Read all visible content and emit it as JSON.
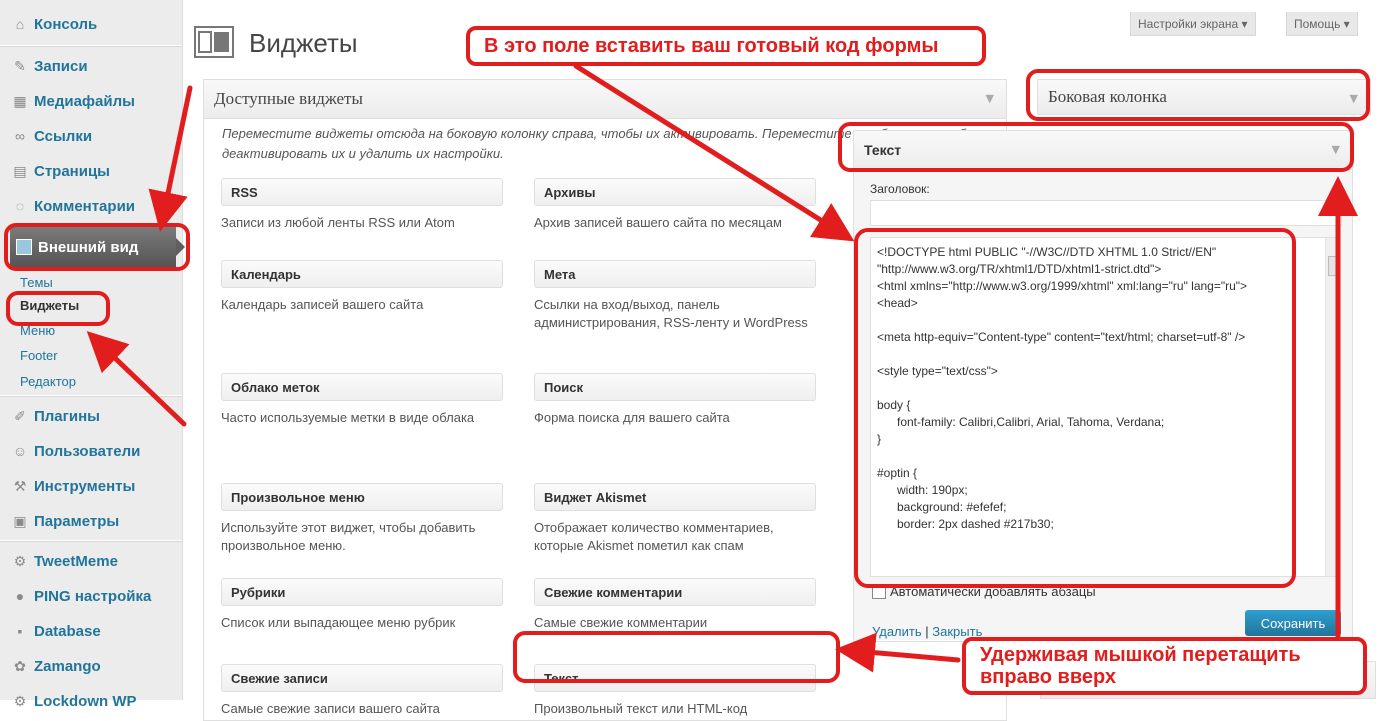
{
  "sidebar": {
    "items": [
      {
        "icon": "home-icon",
        "glyph": "⌂",
        "label": "Консоль"
      },
      {
        "icon": "pin-icon",
        "glyph": "✎",
        "label": "Записи"
      },
      {
        "icon": "media-icon",
        "glyph": "▦",
        "label": "Медиафайлы"
      },
      {
        "icon": "link-icon",
        "glyph": "∞",
        "label": "Ссылки"
      },
      {
        "icon": "page-icon",
        "glyph": "▤",
        "label": "Страницы"
      },
      {
        "icon": "comment-icon",
        "glyph": "◌",
        "label": "Комментарии"
      },
      {
        "icon": "appearance-icon",
        "glyph": "",
        "label": "Внешний вид"
      },
      {
        "icon": "plugin-icon",
        "glyph": "✐",
        "label": "Плагины"
      },
      {
        "icon": "users-icon",
        "glyph": "☺",
        "label": "Пользователи"
      },
      {
        "icon": "tools-icon",
        "glyph": "⚒",
        "label": "Инструменты"
      },
      {
        "icon": "settings-icon",
        "glyph": "▣",
        "label": "Параметры"
      },
      {
        "icon": "gear-icon",
        "glyph": "⚙",
        "label": "TweetMeme"
      },
      {
        "icon": "globe-icon",
        "glyph": "●",
        "label": "PING настройка"
      },
      {
        "icon": "database-icon",
        "glyph": "▪",
        "label": "Database"
      },
      {
        "icon": "zamango-icon",
        "glyph": "✿",
        "label": "Zamango"
      },
      {
        "icon": "lock-icon",
        "glyph": "⚙",
        "label": "Lockdown WP"
      }
    ],
    "submenu": [
      "Темы",
      "Виджеты",
      "Меню",
      "Footer",
      "Редактор"
    ]
  },
  "header": {
    "title": "Виджеты",
    "screen_options": "Настройки экрана ▾",
    "help": "Помощь ▾"
  },
  "available": {
    "title": "Доступные виджеты",
    "description": "Переместите виджеты отсюда на боковую колонку справа, чтобы их активировать. Переместите их обратно, чтобы деактивировать их и удалить их настройки.",
    "widgets": [
      {
        "title": "RSS",
        "desc": "Записи из любой ленты RSS или Atom"
      },
      {
        "title": "Архивы",
        "desc": "Архив записей вашего сайта по месяцам"
      },
      {
        "title": "Календарь",
        "desc": "Календарь записей вашего сайта"
      },
      {
        "title": "Мета",
        "desc": "Ссылки на вход/выход, панель администрирования, RSS-ленту и WordPress"
      },
      {
        "title": "Облако меток",
        "desc": "Часто используемые метки в виде облака"
      },
      {
        "title": "Поиск",
        "desc": "Форма поиска для вашего сайта"
      },
      {
        "title": "Произвольное меню",
        "desc": "Используйте этот виджет, чтобы добавить произвольное меню."
      },
      {
        "title": "Виджет Akismet",
        "desc": "Отображает количество комментариев, которые Akismet пометил как спам"
      },
      {
        "title": "Рубрики",
        "desc": "Список или выпадающее меню рубрик"
      },
      {
        "title": "Свежие комментарии",
        "desc": "Самые свежие комментарии"
      },
      {
        "title": "Свежие записи",
        "desc": "Самые свежие записи вашего сайта"
      },
      {
        "title": "Текст",
        "desc": "Произвольный текст или HTML-код"
      }
    ]
  },
  "sidebar_panel": {
    "title": "Боковая колонка",
    "text_widget": {
      "title": "Текст",
      "label_title": "Заголовок:",
      "code": "<!DOCTYPE html PUBLIC \"-//W3C//DTD XHTML 1.0 Strict//EN\"\n\"http://www.w3.org/TR/xhtml1/DTD/xhtml1-strict.dtd\">\n<html xmlns=\"http://www.w3.org/1999/xhtml\" xml:lang=\"ru\" lang=\"ru\">\n<head>\n\n<meta http-equiv=\"Content-type\" content=\"text/html; charset=utf-8\" />\n\n<style type=\"text/css\">\n\nbody {\n      font-family: Calibri,Calibri, Arial, Tahoma, Verdana;\n}\n\n#optin {\n      width: 190px;\n      background: #efefef;\n      border: 2px dashed #217b30;",
      "auto_p": "Автоматически добавлять абзацы",
      "delete": "Удалить",
      "separator": "|",
      "close": "Закрыть",
      "save": "Сохранить"
    }
  },
  "annotations": {
    "top": "В это поле вставить ваш готовый код формы",
    "bottom": "Удерживая мышкой перетащить вправо вверх",
    "color": "#e21d1d"
  }
}
